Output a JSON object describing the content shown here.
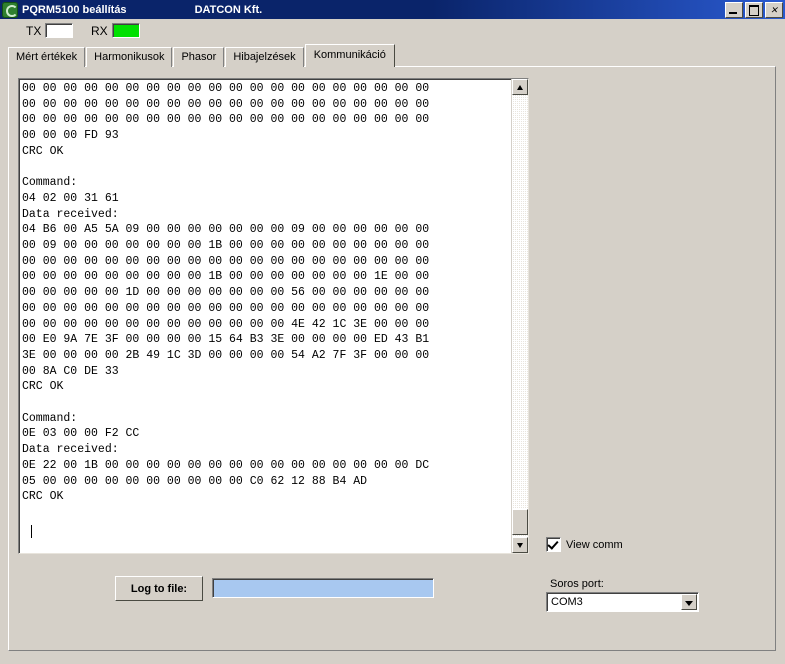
{
  "window": {
    "title": "PQRM5100 beállítás",
    "company": "DATCON Kft.",
    "app_icon": "circle-green-icon",
    "controls": {
      "minimize": "minimize-icon",
      "maximize": "maximize-icon",
      "close": "close-icon"
    }
  },
  "indicators": {
    "tx_label": "TX",
    "tx_color": "#ffffff",
    "rx_label": "RX",
    "rx_color": "#00e000"
  },
  "tabs": [
    {
      "label": "Mért értékek",
      "active": false
    },
    {
      "label": "Harmonikusok",
      "active": false
    },
    {
      "label": "Phasor",
      "active": false
    },
    {
      "label": "Hibajelzések",
      "active": false
    },
    {
      "label": "Kommunikáció",
      "active": true
    }
  ],
  "log": {
    "content": "00 00 00 00 00 00 00 00 00 00 00 00 00 00 00 00 00 00 00 00\n00 00 00 00 00 00 00 00 00 00 00 00 00 00 00 00 00 00 00 00\n00 00 00 00 00 00 00 00 00 00 00 00 00 00 00 00 00 00 00 00\n00 00 00 FD 93\nCRC OK\n\nCommand:\n04 02 00 31 61\nData received:\n04 B6 00 A5 5A 09 00 00 00 00 00 00 00 09 00 00 00 00 00 00\n00 09 00 00 00 00 00 00 00 1B 00 00 00 00 00 00 00 00 00 00\n00 00 00 00 00 00 00 00 00 00 00 00 00 00 00 00 00 00 00 00\n00 00 00 00 00 00 00 00 00 1B 00 00 00 00 00 00 00 1E 00 00\n00 00 00 00 00 1D 00 00 00 00 00 00 00 56 00 00 00 00 00 00\n00 00 00 00 00 00 00 00 00 00 00 00 00 00 00 00 00 00 00 00\n00 00 00 00 00 00 00 00 00 00 00 00 00 4E 42 1C 3E 00 00 00\n00 E0 9A 7E 3F 00 00 00 00 15 64 B3 3E 00 00 00 00 ED 43 B1\n3E 00 00 00 00 2B 49 1C 3D 00 00 00 00 54 A2 7F 3F 00 00 00\n00 8A C0 DE 33\nCRC OK\n\nCommand:\n0E 03 00 00 F2 CC\nData received:\n0E 22 00 1B 00 00 00 00 00 00 00 00 00 00 00 00 00 00 00 DC\n05 00 00 00 00 00 00 00 00 00 00 C0 62 12 88 B4 AD\nCRC OK\n"
  },
  "scrollbar": {
    "up_icon": "scroll-up-arrow-icon",
    "down_icon": "scroll-down-arrow-icon",
    "thumb": "scrollbar-thumb"
  },
  "options": {
    "view_comm_label": "View comm",
    "view_comm_checked": true,
    "serial_port_label": "Soros port:",
    "serial_port_value": "COM3"
  },
  "bottom": {
    "log_button_label": "Log to file:",
    "log_path_value": "",
    "log_field_color": "#a8c8f0"
  }
}
